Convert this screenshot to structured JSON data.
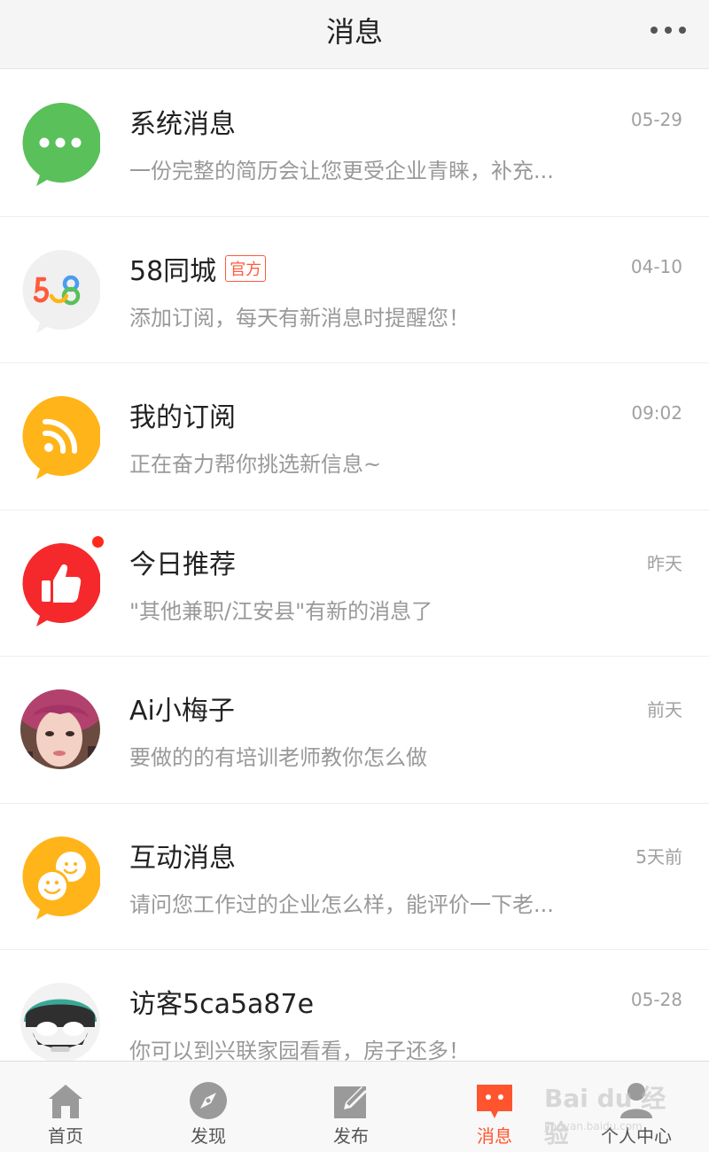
{
  "header": {
    "title": "消息",
    "more_icon": "more-dots-icon"
  },
  "messages": [
    {
      "name": "系统消息",
      "preview": "一份完整的简历会让您更受企业青睐，补充...",
      "time": "05-29",
      "icon": "chat-dots-icon",
      "color": "#5ac05a"
    },
    {
      "name": "58同城",
      "badge": "官方",
      "preview": "添加订阅，每天有新消息时提醒您！",
      "time": "04-10",
      "icon": "58-logo-icon",
      "color": "#f2f2f2"
    },
    {
      "name": "我的订阅",
      "preview": "正在奋力帮你挑选新信息~",
      "time": "09:02",
      "icon": "rss-icon",
      "color": "#ffb419"
    },
    {
      "name": "今日推荐",
      "preview": "\"其他兼职/江安县\"有新的消息了",
      "time": "昨天",
      "icon": "thumbs-up-icon",
      "color": "#f5292b",
      "unread": true
    },
    {
      "name": "Ai小梅子",
      "preview": "要做的的有培训老师教你怎么做",
      "time": "前天",
      "icon": "user-photo-avatar"
    },
    {
      "name": "互动消息",
      "preview": "请问您工作过的企业怎么样，能评价一下老...",
      "time": "5天前",
      "icon": "smiley-faces-icon",
      "color": "#ffb419"
    },
    {
      "name": "访客5ca5a87e",
      "preview": "你可以到兴联家园看看，房子还多！",
      "time": "05-28",
      "icon": "visitor-avatar-icon"
    }
  ],
  "tabbar": [
    {
      "label": "首页",
      "icon": "home-icon",
      "active": false
    },
    {
      "label": "发现",
      "icon": "compass-icon",
      "active": false
    },
    {
      "label": "发布",
      "icon": "edit-icon",
      "active": false
    },
    {
      "label": "消息",
      "icon": "message-icon",
      "active": true
    },
    {
      "label": "个人中心",
      "icon": "person-icon",
      "active": false
    }
  ],
  "colors": {
    "accent": "#ff552e",
    "tab_inactive": "#9a9a9a"
  },
  "watermark": {
    "main": "Bai du 经验",
    "sub": "jingyan.baidu.com"
  }
}
